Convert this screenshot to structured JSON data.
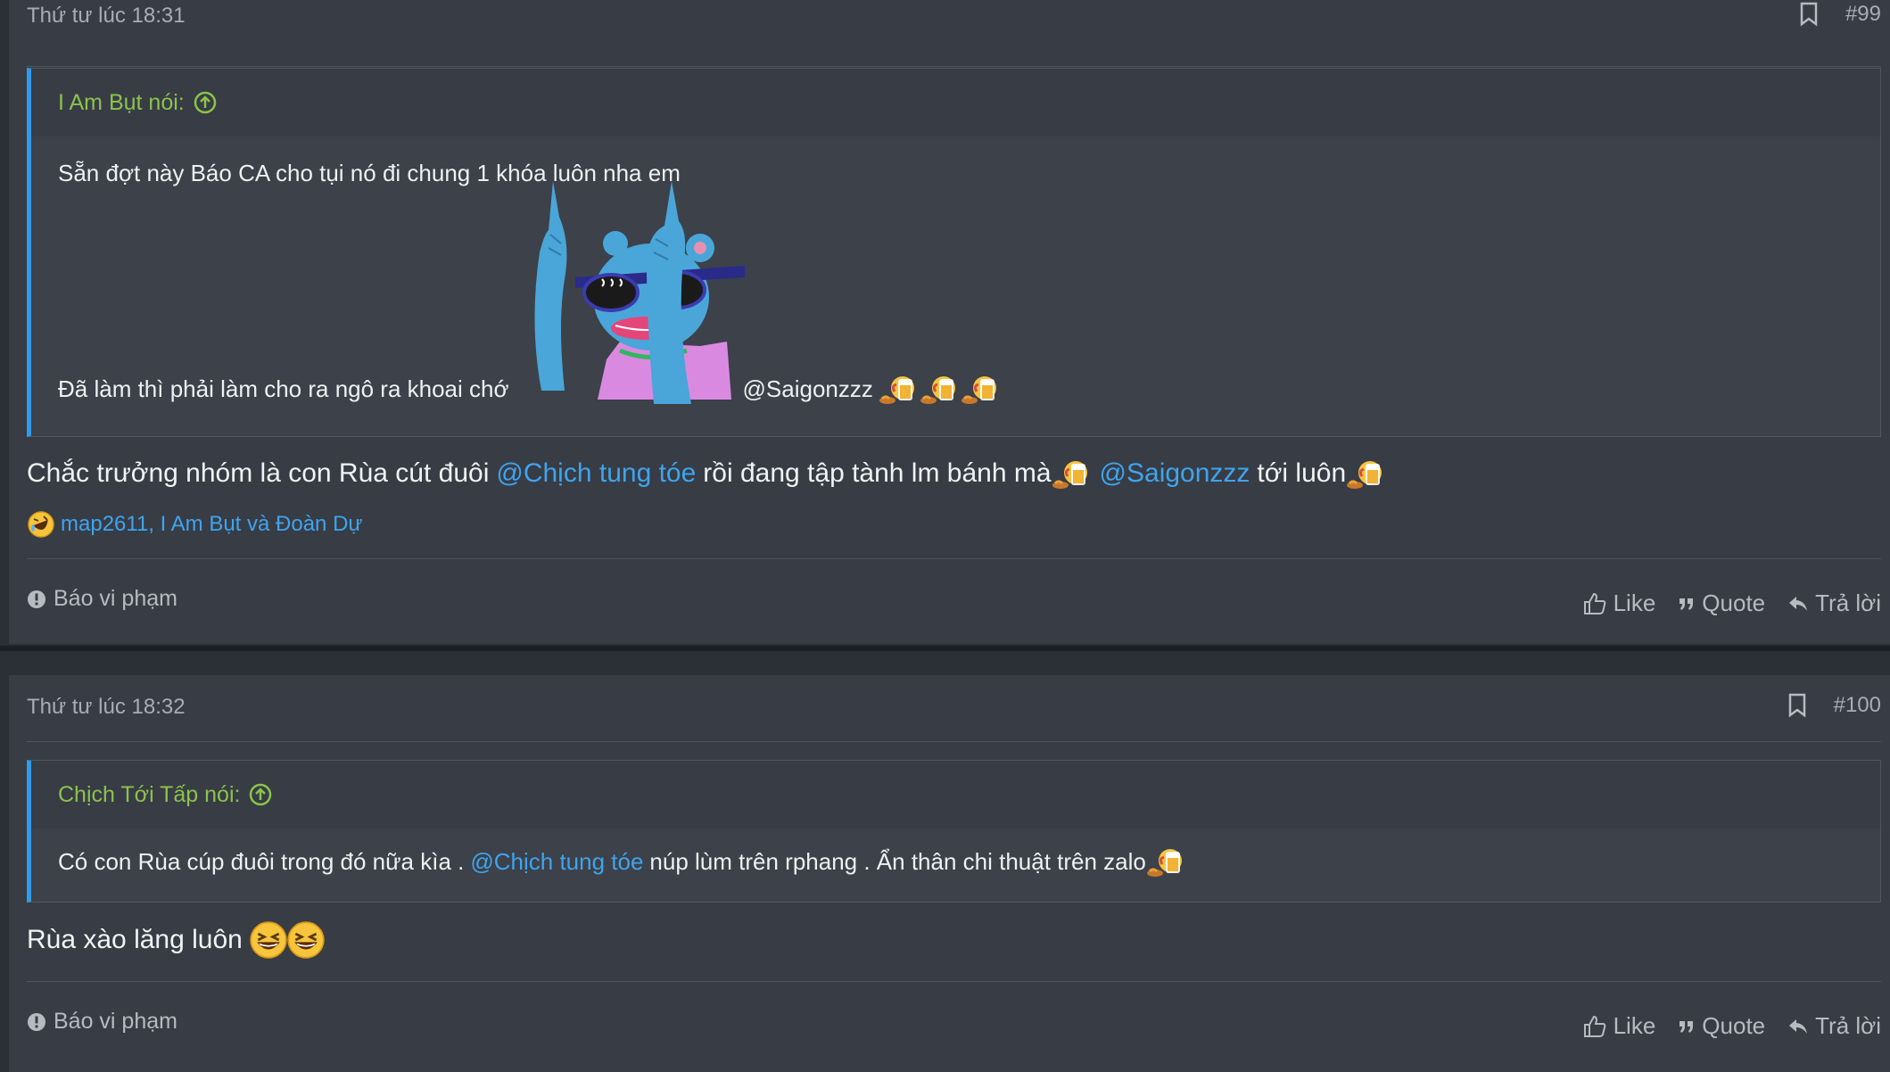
{
  "posts": [
    {
      "date": "Thứ tư lúc 18:31",
      "number": "#99",
      "quote": {
        "author": "I Am Bụt nói:",
        "line1": "Sẵn đợt này Báo CA cho tụi nó đi chung 1 khóa luôn nha em",
        "line2": "Đã làm thì phải làm cho ra ngô ra khoai chớ",
        "mention": "@Saigonzzz"
      },
      "body": {
        "part1": "Chắc trưởng nhóm là con Rùa cút đuôi",
        "mention1": "@Chịch tung tóe",
        "part2": "rồi đang tập tành lm bánh mà",
        "mention2": "@Saigonzzz",
        "part3": "tới luôn"
      },
      "reactions": "map2611, I Am Bụt và Đoàn Dự",
      "report": "Báo vi phạm",
      "like": "Like",
      "quote_btn": "Quote",
      "reply": "Trả lời"
    },
    {
      "date": "Thứ tư lúc 18:32",
      "number": "#100",
      "quote": {
        "author": "Chịch Tới Tấp nói:",
        "part1": "Có con Rùa cúp đuôi trong đó nữa kìa .",
        "mention": "@Chịch tung tóe",
        "part2": "núp lùm trên rphang . Ẩn thân chi thuật trên zalo"
      },
      "body": {
        "text": "Rùa xào lăng luôn"
      },
      "report": "Báo vi phạm",
      "like": "Like",
      "quote_btn": "Quote",
      "reply": "Trả lời"
    }
  ],
  "colors": {
    "background": "#383c45",
    "quote_border": "#2f9bec",
    "author_green": "#8bc34a",
    "mention_blue": "#3fa4ee"
  },
  "icons": [
    "bookmark-icon",
    "arrow-up-circle-icon",
    "laugh-react-icon",
    "warning-icon",
    "thumbs-up-icon",
    "quote-icon",
    "reply-icon",
    "sticker-image",
    "beer-emoji",
    "grinning-emoji"
  ]
}
